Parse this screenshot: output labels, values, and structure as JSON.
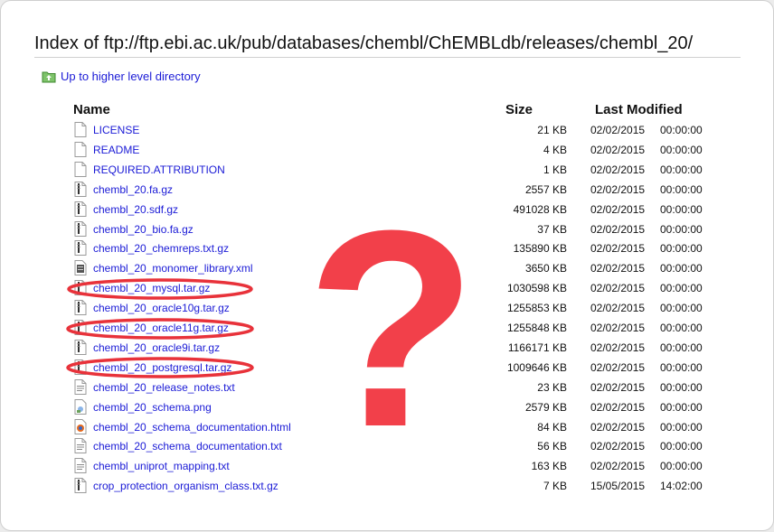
{
  "page": {
    "title": "Index of ftp://ftp.ebi.ac.uk/pub/databases/chembl/ChEMBLdb/releases/chembl_20/",
    "parent_link": "Up to higher level directory"
  },
  "table": {
    "headers": {
      "name": "Name",
      "size": "Size",
      "modified": "Last Modified"
    },
    "rows": [
      {
        "name": "LICENSE",
        "size": "21 KB",
        "date": "02/02/2015",
        "time": "00:00:00",
        "icon": "text-file-icon"
      },
      {
        "name": "README",
        "size": "4 KB",
        "date": "02/02/2015",
        "time": "00:00:00",
        "icon": "text-file-icon"
      },
      {
        "name": "REQUIRED.ATTRIBUTION",
        "size": "1 KB",
        "date": "02/02/2015",
        "time": "00:00:00",
        "icon": "text-file-icon"
      },
      {
        "name": "chembl_20.fa.gz",
        "size": "2557 KB",
        "date": "02/02/2015",
        "time": "00:00:00",
        "icon": "archive-file-icon"
      },
      {
        "name": "chembl_20.sdf.gz",
        "size": "491028 KB",
        "date": "02/02/2015",
        "time": "00:00:00",
        "icon": "archive-file-icon"
      },
      {
        "name": "chembl_20_bio.fa.gz",
        "size": "37 KB",
        "date": "02/02/2015",
        "time": "00:00:00",
        "icon": "archive-file-icon"
      },
      {
        "name": "chembl_20_chemreps.txt.gz",
        "size": "135890 KB",
        "date": "02/02/2015",
        "time": "00:00:00",
        "icon": "archive-file-icon"
      },
      {
        "name": "chembl_20_monomer_library.xml",
        "size": "3650 KB",
        "date": "02/02/2015",
        "time": "00:00:00",
        "icon": "xml-file-icon"
      },
      {
        "name": "chembl_20_mysql.tar.gz",
        "size": "1030598 KB",
        "date": "02/02/2015",
        "time": "00:00:00",
        "icon": "archive-file-icon"
      },
      {
        "name": "chembl_20_oracle10g.tar.gz",
        "size": "1255853 KB",
        "date": "02/02/2015",
        "time": "00:00:00",
        "icon": "archive-file-icon"
      },
      {
        "name": "chembl_20_oracle11g.tar.gz",
        "size": "1255848 KB",
        "date": "02/02/2015",
        "time": "00:00:00",
        "icon": "archive-file-icon"
      },
      {
        "name": "chembl_20_oracle9i.tar.gz",
        "size": "1166171 KB",
        "date": "02/02/2015",
        "time": "00:00:00",
        "icon": "archive-file-icon"
      },
      {
        "name": "chembl_20_postgresql.tar.gz",
        "size": "1009646 KB",
        "date": "02/02/2015",
        "time": "00:00:00",
        "icon": "archive-file-icon"
      },
      {
        "name": "chembl_20_release_notes.txt",
        "size": "23 KB",
        "date": "02/02/2015",
        "time": "00:00:00",
        "icon": "text-lines-file-icon"
      },
      {
        "name": "chembl_20_schema.png",
        "size": "2579 KB",
        "date": "02/02/2015",
        "time": "00:00:00",
        "icon": "image-file-icon"
      },
      {
        "name": "chembl_20_schema_documentation.html",
        "size": "84 KB",
        "date": "02/02/2015",
        "time": "00:00:00",
        "icon": "html-file-icon"
      },
      {
        "name": "chembl_20_schema_documentation.txt",
        "size": "56 KB",
        "date": "02/02/2015",
        "time": "00:00:00",
        "icon": "text-lines-file-icon"
      },
      {
        "name": "chembl_uniprot_mapping.txt",
        "size": "163 KB",
        "date": "02/02/2015",
        "time": "00:00:00",
        "icon": "text-lines-file-icon"
      },
      {
        "name": "crop_protection_organism_class.txt.gz",
        "size": "7 KB",
        "date": "15/05/2015",
        "time": "14:02:00",
        "icon": "archive-file-icon"
      }
    ]
  },
  "annotations": {
    "highlight_color": "#e8323a",
    "question_mark": "?",
    "circled_files": [
      "chembl_20_mysql.tar.gz",
      "chembl_20_oracle11g.tar.gz",
      "chembl_20_postgresql.tar.gz"
    ]
  },
  "colors": {
    "link": "#1a1ad6",
    "text": "#111111",
    "folder": "#5aa84a"
  }
}
